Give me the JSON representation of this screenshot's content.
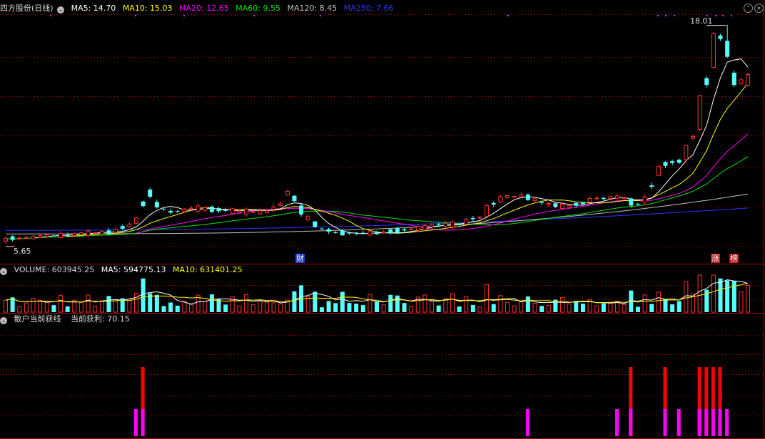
{
  "main_header": {
    "title": "四方股份(日线)",
    "ma5": "MA5: 14.70",
    "ma10": "MA10: 15.03",
    "ma20": "MA20: 12.65",
    "ma60": "MA60: 9.55",
    "ma120": "MA120: 8.45",
    "ma250": "MA250: 7.66"
  },
  "volume_header": {
    "label": "VOLUME: 603945.25",
    "ma5": "MA5: 594775.13",
    "ma10": "MA10: 631401.25"
  },
  "indicator_header": {
    "title": "散户当前获线",
    "value": "当前获利: 70.15"
  },
  "markers": {
    "high_label": "18.01",
    "low_label": "5.65",
    "cai": "财",
    "zhang": "涨",
    "bang": "榜"
  },
  "colors": {
    "up": "#ff3232",
    "down": "#54ffff",
    "ma5": "#ffffff",
    "ma10": "#ffff00",
    "ma20": "#ff00ff",
    "ma60": "#00e600",
    "ma120": "#c0c0c0",
    "ma250": "#3232ff",
    "axis": "#b00000",
    "indicator_red": "#ff0000",
    "indicator_magenta": "#ff00ff"
  },
  "chart_data": [
    {
      "type": "candlestick",
      "price_range": [
        5.0,
        18.6
      ],
      "high": 18.01,
      "low": 5.65,
      "ma": {
        "MA5": 14.7,
        "MA10": 15.03,
        "MA20": 12.65,
        "MA60": 9.55,
        "MA120": 8.45,
        "MA250": 7.66
      },
      "anchors": [
        [
          0,
          5.8,
          5.95
        ],
        [
          5,
          6.0,
          6.1
        ],
        [
          10,
          6.1,
          6.2
        ],
        [
          16,
          6.3,
          6.45
        ],
        [
          19,
          6.8,
          7.1
        ],
        [
          21,
          8.7,
          8.3
        ],
        [
          22,
          8.0,
          7.7
        ],
        [
          24,
          7.5,
          7.4
        ],
        [
          27,
          7.6,
          7.65
        ],
        [
          32,
          7.55,
          7.5
        ],
        [
          38,
          7.4,
          7.5
        ],
        [
          40,
          7.8,
          7.9
        ],
        [
          41,
          8.4,
          8.6
        ],
        [
          43,
          7.8,
          7.3
        ],
        [
          45,
          6.9,
          6.6
        ],
        [
          48,
          6.3,
          6.25
        ],
        [
          55,
          6.25,
          6.3
        ],
        [
          62,
          6.6,
          6.7
        ],
        [
          67,
          6.75,
          7.0
        ],
        [
          70,
          7.2,
          7.8
        ],
        [
          72,
          8.0,
          8.3
        ],
        [
          75,
          8.3,
          8.4
        ],
        [
          78,
          8.0,
          7.95
        ],
        [
          82,
          7.7,
          7.8
        ],
        [
          85,
          8.0,
          8.2
        ],
        [
          88,
          8.2,
          8.3
        ],
        [
          91,
          8.2,
          7.8
        ],
        [
          93,
          8.0,
          8.3
        ],
        [
          95,
          9.5,
          10.0
        ],
        [
          97,
          10.3,
          10.2
        ],
        [
          99,
          10.4,
          11.2
        ],
        [
          101,
          12.1,
          14.0
        ],
        [
          103,
          15.6,
          17.5
        ],
        [
          105,
          17.1,
          16.2
        ],
        [
          106,
          15.3,
          14.6
        ],
        [
          107,
          14.7,
          14.9
        ],
        [
          108,
          14.6,
          15.2
        ]
      ],
      "volume_header_values": {
        "VOLUME": 603945.25,
        "MA5": 594775.13,
        "MA10": 631401.25
      }
    },
    {
      "type": "bar",
      "title": "散户当前获线",
      "value": 70.15,
      "red_bars": [
        20,
        91,
        96,
        101,
        102,
        103,
        104
      ],
      "magenta_bars": [
        19,
        20,
        76,
        89,
        91,
        96,
        98,
        101,
        102,
        103,
        104,
        105
      ]
    }
  ]
}
